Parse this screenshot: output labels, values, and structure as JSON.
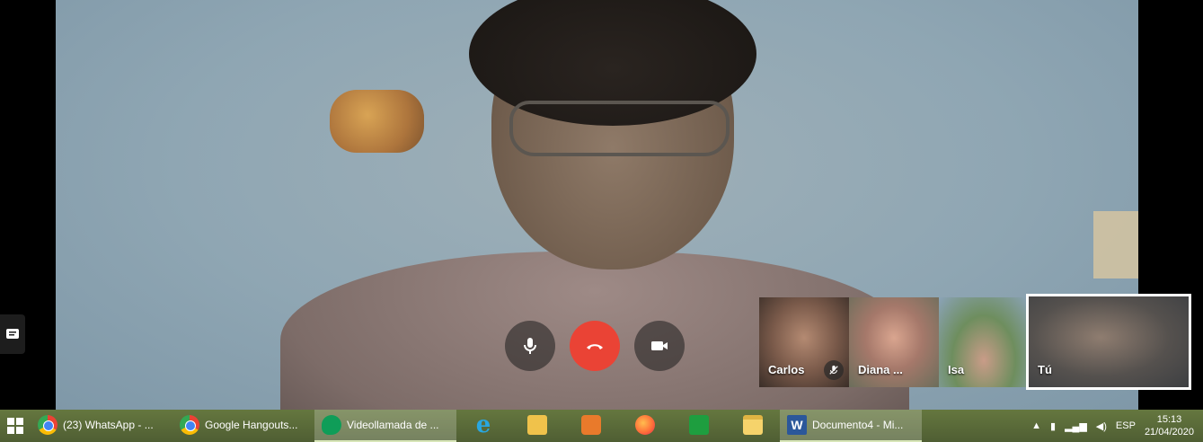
{
  "controls": {
    "mic_icon": "microphone-icon",
    "hangup_icon": "phone-hangup-icon",
    "camera_icon": "video-camera-icon"
  },
  "participants": [
    {
      "name": "Carlos",
      "muted": true
    },
    {
      "name": "Diana ...",
      "muted": false
    },
    {
      "name": "Isa",
      "muted": false
    }
  ],
  "self_view": {
    "name": "Tú"
  },
  "taskbar": {
    "items": [
      {
        "label": "(23) WhatsApp - ...",
        "icon": "chrome-icon"
      },
      {
        "label": "Google Hangouts...",
        "icon": "chrome-icon"
      },
      {
        "label": "Videollamada de ...",
        "icon": "hangouts-icon",
        "active": true
      },
      {
        "label": "Documento4 - Mi...",
        "icon": "word-icon"
      }
    ],
    "tray": {
      "language": "ESP",
      "time": "15:13",
      "date": "21/04/2020"
    }
  },
  "colors": {
    "hangup": "#ea4335",
    "taskbar": "#5a6a3c"
  }
}
